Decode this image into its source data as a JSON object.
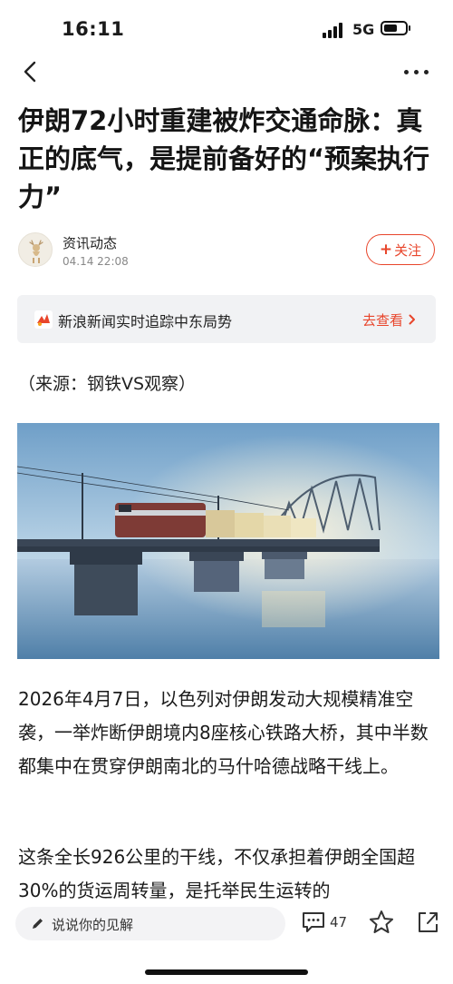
{
  "status_bar": {
    "time": "16:11",
    "network": "5G"
  },
  "article": {
    "title": "伊朗72小时重建被炸交通命脉：真正的底气，是提前备好的“预案执行力”",
    "author": {
      "name": "资讯动态",
      "time": "04.14  22:08"
    },
    "follow_label": "关注",
    "banner": {
      "text": "新浪新闻实时追踪中东局势",
      "link": "去查看"
    },
    "source_line": "（来源：钢铁VS观察）",
    "paragraphs": [
      "2026年4月7日，以色列对伊朗发动大规模精准空袭，一举炸断伊朗境内8座核心铁路大桥，其中半数都集中在贯穿伊朗南北的马什哈德战略干线上。",
      "这条全长926公里的干线，不仅承担着伊朗全国超30%的货运周转量，是托举民生运转的"
    ]
  },
  "bottom_bar": {
    "comment_placeholder": "说说你的见解",
    "comment_count": "47"
  },
  "colors": {
    "accent": "#e8452b",
    "banner_bg": "#f1f2f4"
  },
  "icons": [
    "back-icon",
    "more-icon",
    "sina-logo-icon",
    "chevron-right-icon",
    "pencil-icon",
    "comment-icon",
    "star-icon",
    "share-icon"
  ]
}
